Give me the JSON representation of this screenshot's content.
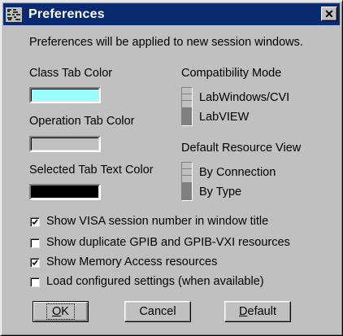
{
  "window": {
    "title": "Preferences",
    "close_glyph": "✕"
  },
  "intro": "Preferences will be applied to new session windows.",
  "colors": {
    "class_tab": {
      "label": "Class Tab Color",
      "value": "#99ffff"
    },
    "operation_tab": {
      "label": "Operation Tab Color",
      "value": "#c0c0c0"
    },
    "selected_tab_text": {
      "label": "Selected Tab Text Color",
      "value": "#000000"
    }
  },
  "compatibility": {
    "label": "Compatibility Mode",
    "options": [
      "LabWindows/CVI",
      "LabVIEW"
    ],
    "selected": "LabVIEW"
  },
  "resource_view": {
    "label": "Default Resource View",
    "options": [
      "By Connection",
      "By Type"
    ],
    "selected": "By Type"
  },
  "checkboxes": [
    {
      "label": "Show VISA session number in window title",
      "checked": true
    },
    {
      "label": "Show duplicate GPIB and GPIB-VXI resources",
      "checked": false
    },
    {
      "label": "Show Memory Access resources",
      "checked": true
    },
    {
      "label": "Load configured settings (when available)",
      "checked": false
    }
  ],
  "buttons": {
    "ok": {
      "mnemonic": "O",
      "rest": "K"
    },
    "cancel": "Cancel",
    "default": {
      "mnemonic": "D",
      "rest": "efault"
    }
  }
}
